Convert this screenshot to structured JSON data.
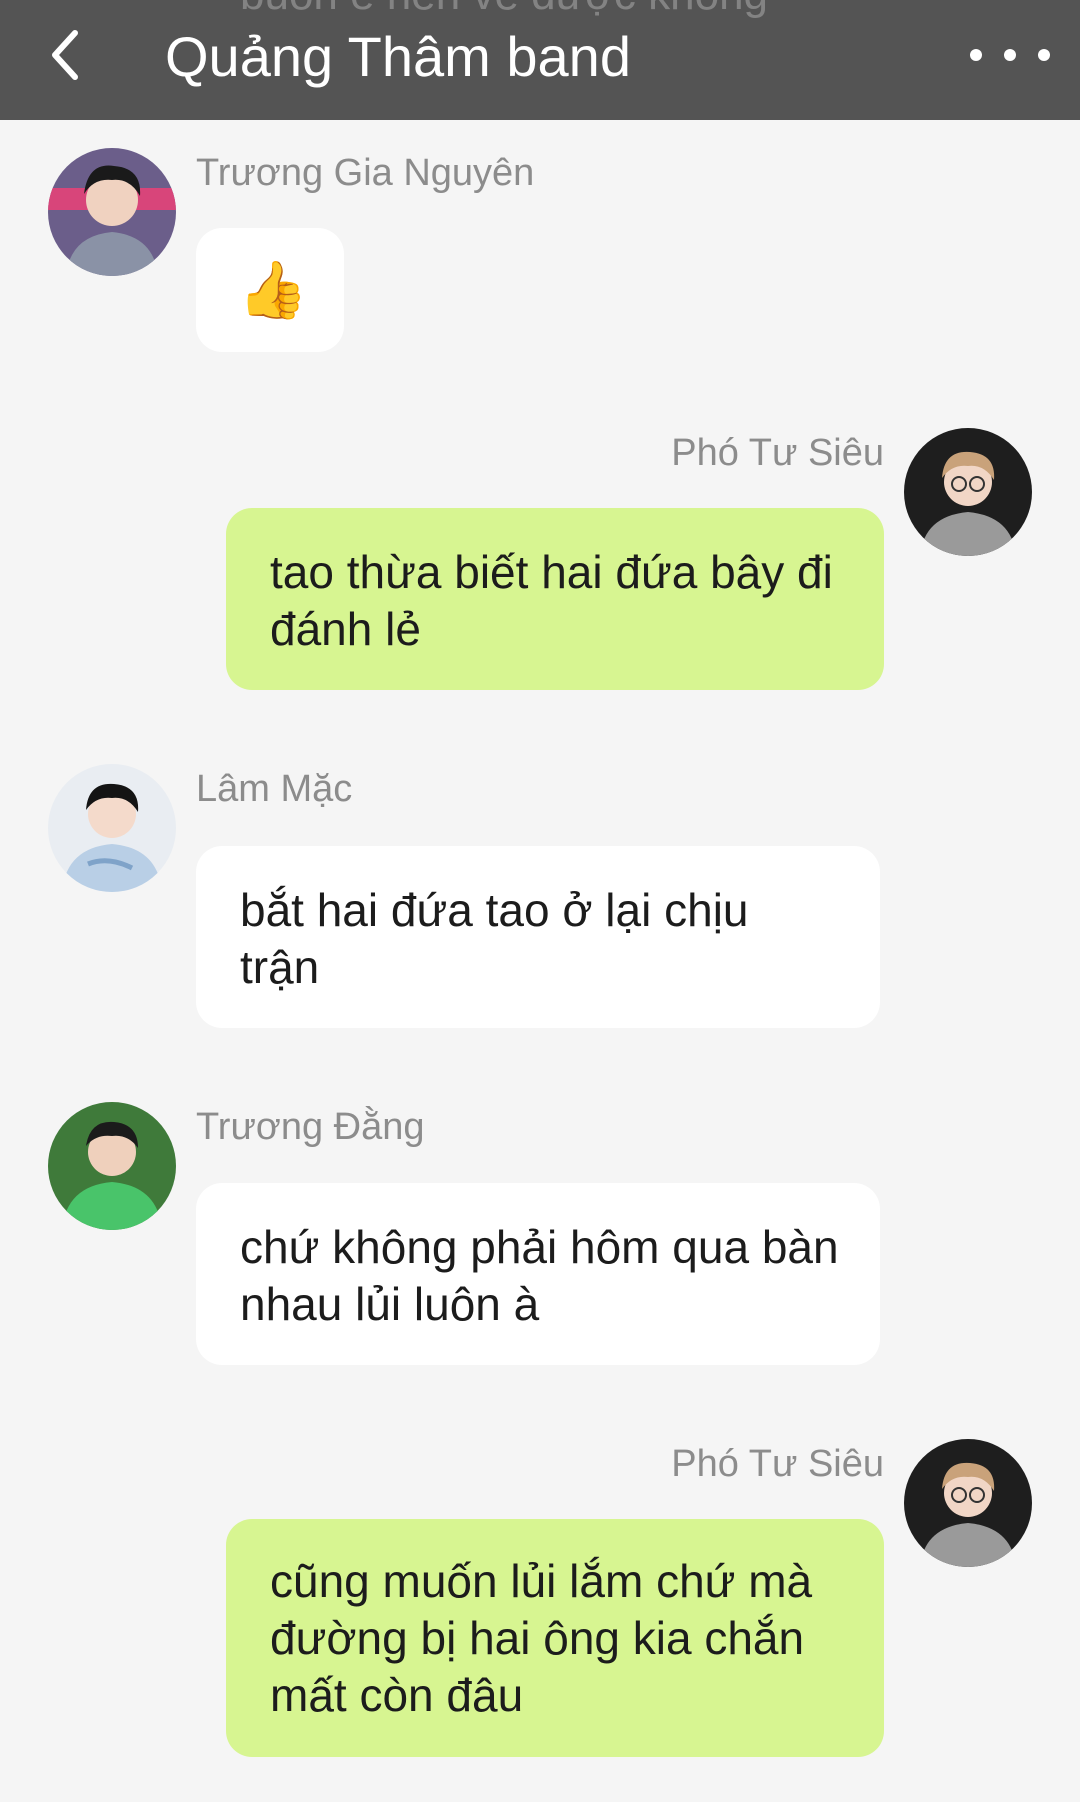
{
  "header": {
    "title": "Quảng Thâm band",
    "behind_text": "buồn e nên về được không"
  },
  "messages": [
    {
      "sender": "Trương Gia Nguyên",
      "text": "👍",
      "direction": "incoming"
    },
    {
      "sender": "Phó Tư Siêu",
      "text": "tao thừa biết hai đứa bây đi đánh lẻ",
      "direction": "outgoing"
    },
    {
      "sender": "Lâm Mặc",
      "text": "bắt hai đứa tao ở lại chịu trận",
      "direction": "incoming"
    },
    {
      "sender": "Trương Đằng",
      "text": "chứ không phải hôm qua bàn nhau lủi luôn à",
      "direction": "incoming"
    },
    {
      "sender": "Phó Tư Siêu",
      "text": "cũng muốn lủi lắm chứ mà đường bị hai ông kia chắn mất còn đâu",
      "direction": "outgoing"
    }
  ],
  "colors": {
    "header_bg": "#545454",
    "page_bg": "#f5f5f5",
    "incoming_bubble": "#ffffff",
    "outgoing_bubble": "#d7f591",
    "sender_name": "#8c8c8c"
  },
  "icons": {
    "back": "chevron-left-icon",
    "more": "more-dots-icon"
  }
}
